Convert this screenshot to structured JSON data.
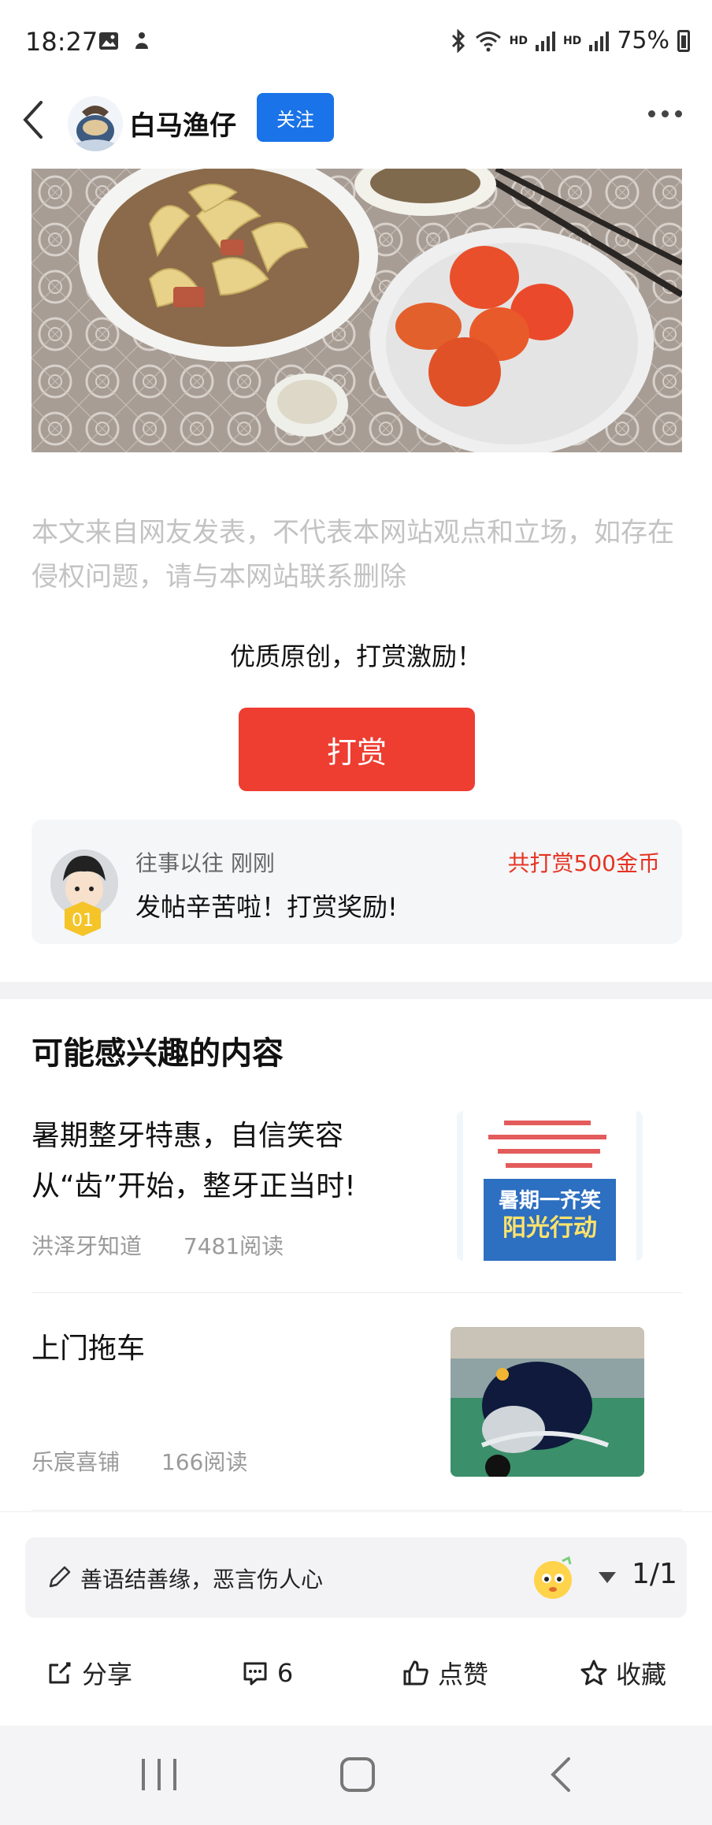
{
  "status_bar": {
    "time": "18:27",
    "hd1": "HD",
    "hd2": "HD",
    "battery": "75%",
    "icons": [
      "gallery-icon",
      "notification-icon",
      "bluetooth-icon",
      "wifi-icon",
      "signal-icon",
      "battery-icon"
    ]
  },
  "header": {
    "author": "白马渔仔",
    "follow_label": "关注",
    "icons": [
      "back-icon",
      "more-icon"
    ]
  },
  "article": {
    "disclaimer": "本文来自网友发表，不代表本网站观点和立场，如存在侵权问题，请与本网站联系删除"
  },
  "reward": {
    "title": "优质原创，打赏激励！",
    "button_label": "打赏",
    "record": {
      "user_time": "往事以往 刚刚",
      "message": "发帖辛苦啦！打赏奖励!",
      "total": "共打赏500金币",
      "badge": "01"
    }
  },
  "recommendations": {
    "section_title": "可能感兴趣的内容",
    "items": [
      {
        "title": "暑期整牙特惠，自信笑容从“齿”开始，整牙正当时!",
        "source": "洪泽牙知道",
        "reads": "7481阅读",
        "thumb_text_main": "暑期一齐笑",
        "thumb_text_sub": "阳光行动"
      },
      {
        "title": "上门拖车",
        "source": "乐宸喜铺",
        "reads": "166阅读"
      }
    ]
  },
  "comment_bar": {
    "placeholder": "善语结善缘，恶言伤人心",
    "page": "1/1"
  },
  "actions": {
    "share": "分享",
    "comments": "6",
    "like": "点赞",
    "favorite": "收藏"
  },
  "colors": {
    "accent_blue": "#1a73e8",
    "reward_red": "#ee3d31",
    "total_red": "#e53423"
  }
}
